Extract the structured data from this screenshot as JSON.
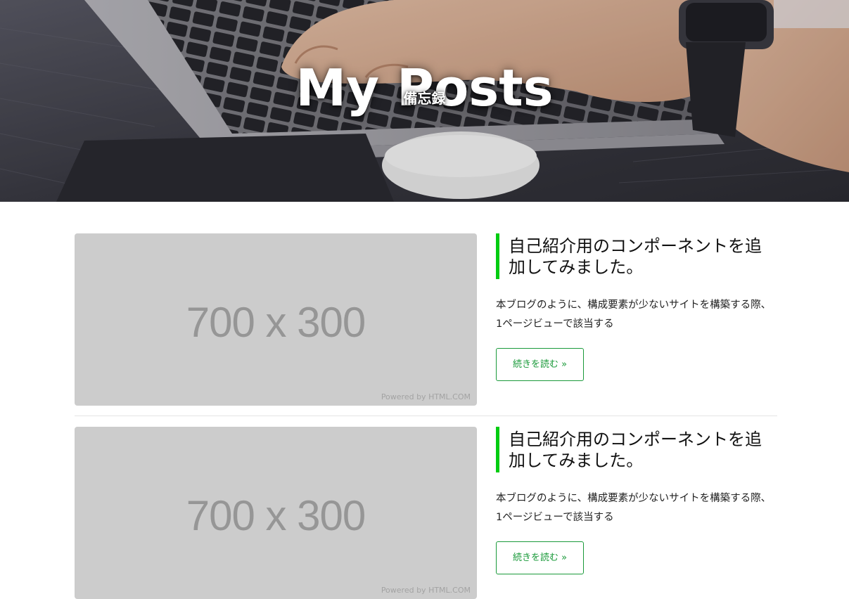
{
  "hero": {
    "title": "My Posts",
    "subtitle": "備忘録"
  },
  "posts": [
    {
      "thumbnail_text": "700 x 300",
      "thumbnail_credit": "Powered by HTML.COM",
      "title": "自己紹介用のコンポーネントを追加してみました。",
      "excerpt": "本ブログのように、構成要素が少ないサイトを構築する際、1ページビューで該当する",
      "read_more": "続きを読む »"
    },
    {
      "thumbnail_text": "700 x 300",
      "thumbnail_credit": "Powered by HTML.COM",
      "title": "自己紹介用のコンポーネントを追加してみました。",
      "excerpt": "本ブログのように、構成要素が少ないサイトを構築する際、1ページビューで該当する",
      "read_more": "続きを読む »"
    }
  ],
  "colors": {
    "accent_green": "#00cc11",
    "button_green": "#1a9a3a",
    "placeholder_bg": "#cccccc"
  }
}
